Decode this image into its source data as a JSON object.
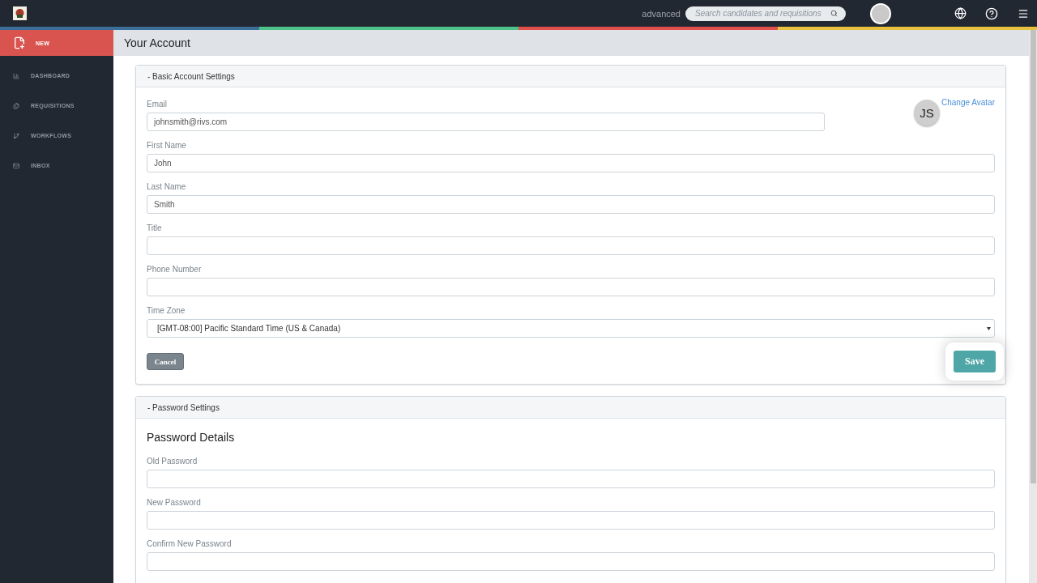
{
  "topbar": {
    "advanced_link": "advanced",
    "search": {
      "placeholder": "Search candidates and requisitions"
    }
  },
  "sidebar": {
    "items": [
      {
        "label": "NEW",
        "selected": true
      },
      {
        "label": "DASHBOARD",
        "selected": false
      },
      {
        "label": "REQUISITIONS",
        "selected": false
      },
      {
        "label": "WORKFLOWS",
        "selected": false
      },
      {
        "label": "INBOX",
        "selected": false
      }
    ]
  },
  "page_title": "Your Account",
  "basic_settings": {
    "header": "- Basic Account Settings",
    "avatar_initials": "JS",
    "change_avatar": "Change Avatar",
    "fields": [
      {
        "label": "Email",
        "value": "johnsmith@rivs.com"
      },
      {
        "label": "First Name",
        "value": "John"
      },
      {
        "label": "Last Name",
        "value": "Smith"
      },
      {
        "label": "Title"
      },
      {
        "label": "Phone Number"
      }
    ],
    "time_zone": {
      "label": "Time Zone",
      "value": "[GMT-08:00] Pacific Standard Time (US & Canada)"
    },
    "buttons": {
      "cancel": "Cancel",
      "save": "Save"
    }
  },
  "password_settings": {
    "header": "- Password Settings",
    "heading": "Password Details",
    "fields": [
      {
        "label": "Old Password"
      },
      {
        "label": "New Password"
      },
      {
        "label": "Confirm New Password"
      }
    ]
  }
}
